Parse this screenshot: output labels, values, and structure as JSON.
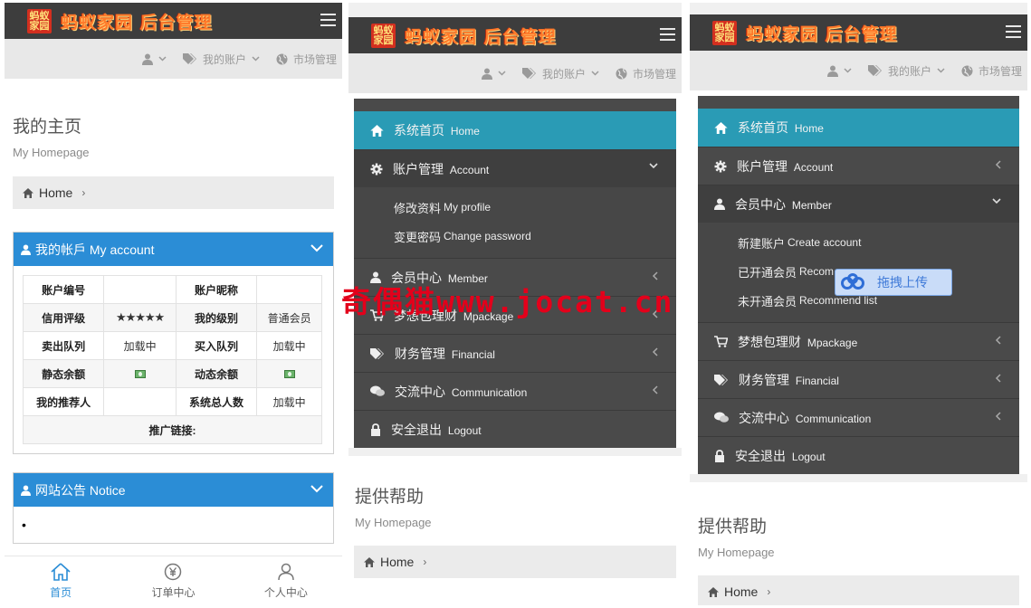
{
  "brand": {
    "logo_line1": "蚂蚁",
    "logo_line2": "家园",
    "title": "蚂蚁家园 后台管理"
  },
  "subnav": {
    "account": "我的账户",
    "market": "市场管理"
  },
  "home_page": {
    "title": "我的主页",
    "subtitle": "My Homepage",
    "breadcrumb": "Home",
    "account_card": {
      "title": "我的帐戶 My account",
      "rows": [
        [
          "账户编号",
          "",
          "账户昵称",
          ""
        ],
        [
          "信用评级",
          "★★★★★",
          "我的级别",
          "普通会员"
        ],
        [
          "卖出队列",
          "加载中",
          "买入队列",
          "加载中"
        ],
        [
          "静态余额",
          "",
          "动态余额",
          ""
        ],
        [
          "我的推荐人",
          "",
          "系统总人数",
          "加载中"
        ]
      ],
      "promo_label": "推广链接:"
    },
    "notice_card": {
      "title": "网站公告 Notice",
      "item": "•"
    },
    "bottom_nav": [
      {
        "label": "首页",
        "icon": "home-icon",
        "active": true
      },
      {
        "label": "订单中心",
        "icon": "yen-circle-icon",
        "active": false
      },
      {
        "label": "个人中心",
        "icon": "user-icon",
        "active": false
      }
    ]
  },
  "menu_mid": {
    "items": [
      {
        "zh": "系统首页",
        "en": "Home",
        "icon": "home-icon",
        "state": "active",
        "arrow": ""
      },
      {
        "zh": "账户管理",
        "en": "Account",
        "icon": "gear-icon",
        "state": "open",
        "arrow": "down"
      },
      {
        "zh": "会员中心",
        "en": "Member",
        "icon": "user-icon",
        "state": "",
        "arrow": "left"
      },
      {
        "zh": "梦想包理财",
        "en": "Mpackage",
        "icon": "cart-icon",
        "state": "",
        "arrow": "left"
      },
      {
        "zh": "财务管理",
        "en": "Financial",
        "icon": "tags-icon",
        "state": "",
        "arrow": "left"
      },
      {
        "zh": "交流中心",
        "en": "Communication",
        "icon": "comments-icon",
        "state": "",
        "arrow": "left"
      },
      {
        "zh": "安全退出",
        "en": "Logout",
        "icon": "lock-icon",
        "state": "",
        "arrow": ""
      }
    ],
    "submenu": [
      {
        "zh": "修改资料",
        "en": "My profile"
      },
      {
        "zh": "变更密码",
        "en": "Change password"
      }
    ],
    "page_title": "提供帮助",
    "page_subtitle": "My Homepage",
    "breadcrumb": "Home"
  },
  "menu_right": {
    "items": [
      {
        "zh": "系统首页",
        "en": "Home",
        "icon": "home-icon",
        "state": "active",
        "arrow": ""
      },
      {
        "zh": "账户管理",
        "en": "Account",
        "icon": "gear-icon",
        "state": "",
        "arrow": "left"
      },
      {
        "zh": "会员中心",
        "en": "Member",
        "icon": "user-icon",
        "state": "open",
        "arrow": "down"
      },
      {
        "zh": "梦想包理财",
        "en": "Mpackage",
        "icon": "cart-icon",
        "state": "",
        "arrow": "left"
      },
      {
        "zh": "财务管理",
        "en": "Financial",
        "icon": "tags-icon",
        "state": "",
        "arrow": "left"
      },
      {
        "zh": "交流中心",
        "en": "Communication",
        "icon": "comments-icon",
        "state": "",
        "arrow": "left"
      },
      {
        "zh": "安全退出",
        "en": "Logout",
        "icon": "lock-icon",
        "state": "",
        "arrow": ""
      }
    ],
    "submenu": [
      {
        "zh": "新建账户",
        "en": "Create account"
      },
      {
        "zh": "已开通会员",
        "en": "Recom"
      },
      {
        "zh": "未开通会员",
        "en": "Recommend list"
      }
    ],
    "page_title": "提供帮助",
    "page_subtitle": "My Homepage",
    "breadcrumb": "Home"
  },
  "overlay": {
    "upload_label": "拖拽上传",
    "watermark": "奇偶猫www.jocat.cn"
  },
  "colors": {
    "topbar": "#3d3d3d",
    "menu_bg": "#4a4a4a",
    "menu_active": "#2a9bb5",
    "card_header": "#2b8dd6",
    "watermark": "#e3001b"
  }
}
